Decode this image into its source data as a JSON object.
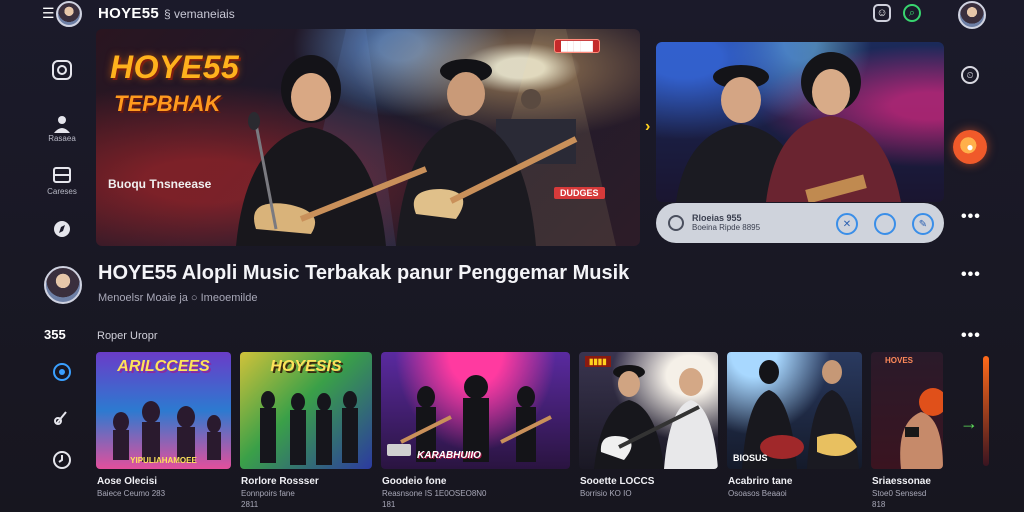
{
  "header": {
    "brand": "HOYE55",
    "subtitle": "§ vemaneiais",
    "menu_icon": "hamburger-icon",
    "right_icons": [
      "chat-icon",
      "search-icon"
    ]
  },
  "left_rail": [
    {
      "icon": "home-icon",
      "label": ""
    },
    {
      "icon": "user-icon",
      "label": "Rasaea"
    },
    {
      "icon": "library-icon",
      "label": "Careses"
    },
    {
      "icon": "explore-icon",
      "label": ""
    }
  ],
  "hero": {
    "title": "HOYE55",
    "subtitle": "TEPBHAK",
    "caption": "Buoqu Tnsneease",
    "badge_top": "█████",
    "badge_bottom": "DUDGES"
  },
  "player": {
    "title": "Rloeias 955",
    "subtitle": "Boeina Ripde 8895"
  },
  "main": {
    "title": "HOYE55 Alopli Music Terbakak  panur Penggemar Musik",
    "meta": "Menoelsr Moaie ja  ○  Imeoemilde",
    "count": "355",
    "section_label": "Roper Uropr"
  },
  "cards": [
    {
      "art_title": "ARILCCEES",
      "foot": "YIPULIAHAMOEE",
      "name": "Aose Olecisi",
      "sub": "Baiece Ceumo 283",
      "sub2": ""
    },
    {
      "art_title": "HOYESIS",
      "foot": "",
      "name": "Rorlore Rossser",
      "sub": "Eonnpoirs fane",
      "sub2": "2811"
    },
    {
      "art_title": "",
      "foot": "KARABHUIIO",
      "name": "Goodeio fone",
      "sub": "Reasnsone IS 1E0OSEO8N0",
      "sub2": "181"
    },
    {
      "art_title": "",
      "foot": "",
      "name": "Sooette LOCCS",
      "sub": "Borrisio KO IO",
      "sub2": ""
    },
    {
      "art_title": "",
      "foot": "BIOSUS",
      "name": "Acabriro tane",
      "sub": "Osoasos Beaaoi",
      "sub2": ""
    },
    {
      "art_title": "HOVES",
      "foot": "",
      "name": "Sriaessonae",
      "sub": "Stoe0 Sensesd",
      "sub2": "818"
    }
  ],
  "colors": {
    "background": "#1b1a2a",
    "hero_title": "#ffb21d",
    "accent_green": "#38d56f",
    "accent_orange": "#f05a2a",
    "player_bg": "#cfd3dc",
    "player_btn": "#3a8ee8"
  }
}
